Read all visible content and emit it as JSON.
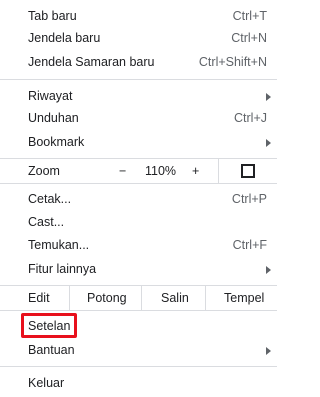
{
  "menu": {
    "group1": [
      {
        "label": "Tab baru",
        "shortcut": "Ctrl+T"
      },
      {
        "label": "Jendela baru",
        "shortcut": "Ctrl+N"
      },
      {
        "label": "Jendela Samaran baru",
        "shortcut": "Ctrl+Shift+N"
      }
    ],
    "group2": [
      {
        "label": "Riwayat"
      },
      {
        "label": "Unduhan",
        "shortcut": "Ctrl+J"
      },
      {
        "label": "Bookmark"
      }
    ],
    "zoom": {
      "label": "Zoom",
      "minus": "−",
      "value": "110%",
      "plus": "+"
    },
    "group3": [
      {
        "label": "Cetak...",
        "shortcut": "Ctrl+P"
      },
      {
        "label": "Cast..."
      },
      {
        "label": "Temukan...",
        "shortcut": "Ctrl+F"
      },
      {
        "label": "Fitur lainnya"
      }
    ],
    "edit": {
      "label": "Edit",
      "cut": "Potong",
      "copy": "Salin",
      "paste": "Tempel"
    },
    "group4": [
      {
        "label": "Setelan"
      },
      {
        "label": "Bantuan"
      }
    ],
    "exit": {
      "label": "Keluar"
    }
  },
  "colors": {
    "highlight": "#e8101c"
  }
}
